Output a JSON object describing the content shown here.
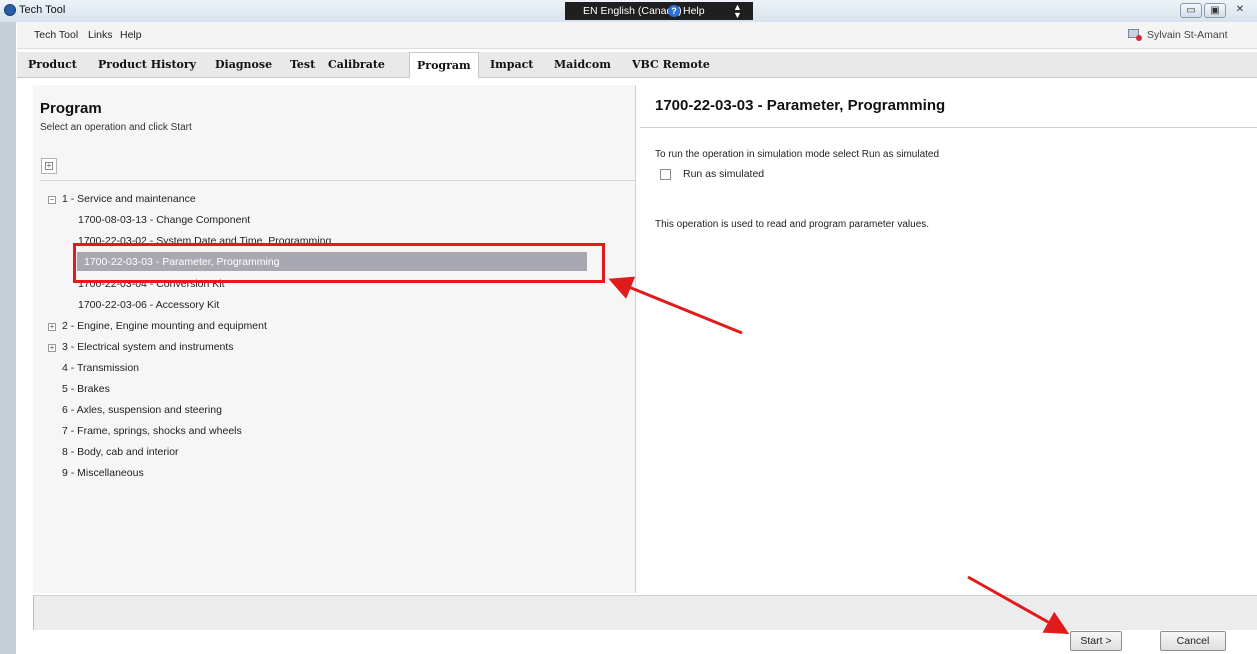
{
  "window": {
    "title": "Tech Tool",
    "language": "EN English (Canada)",
    "help": "Help"
  },
  "menu": {
    "items": [
      "Tech Tool",
      "Links",
      "Help"
    ],
    "user": "Sylvain St-Amant"
  },
  "tabs": [
    "Product",
    "Product History",
    "Diagnose",
    "Test",
    "Calibrate",
    "Program",
    "Impact",
    "Maidcom",
    "VBC Remote"
  ],
  "active_tab": "Program",
  "left": {
    "title": "Program",
    "subtitle": "Select an operation and click Start",
    "tree": [
      {
        "label": "1 - Service and maintenance",
        "toggle": "−"
      },
      {
        "label": "1700-08-03-13 - Change Component"
      },
      {
        "label": "1700-22-03-02 - System Date and Time, Programming"
      },
      {
        "label": "1700-22-03-03 - Parameter, Programming",
        "selected": true
      },
      {
        "label": "1700-22-03-04 - Conversion Kit"
      },
      {
        "label": "1700-22-03-06 - Accessory Kit"
      },
      {
        "label": "2 - Engine, Engine mounting and equipment",
        "toggle": "+"
      },
      {
        "label": "3 - Electrical system and instruments",
        "toggle": "+"
      },
      {
        "label": "4 - Transmission"
      },
      {
        "label": "5 - Brakes"
      },
      {
        "label": "6 - Axles, suspension and steering"
      },
      {
        "label": "7 - Frame, springs, shocks and wheels"
      },
      {
        "label": "8 - Body, cab and interior"
      },
      {
        "label": "9 - Miscellaneous"
      }
    ]
  },
  "right": {
    "title": "1700-22-03-03 - Parameter, Programming",
    "simulation_hint": "To run the operation in simulation mode select Run as simulated",
    "run_as_simulated": "Run as simulated",
    "run_as_simulated_checked": false,
    "description": "This operation is used to read and program parameter values."
  },
  "footer": {
    "start": "Start >",
    "cancel": "Cancel"
  },
  "colors": {
    "highlight_box": "#e11b1b",
    "annotation_arrow": "#e11b1b",
    "selected_row": "#a8a8b2"
  }
}
